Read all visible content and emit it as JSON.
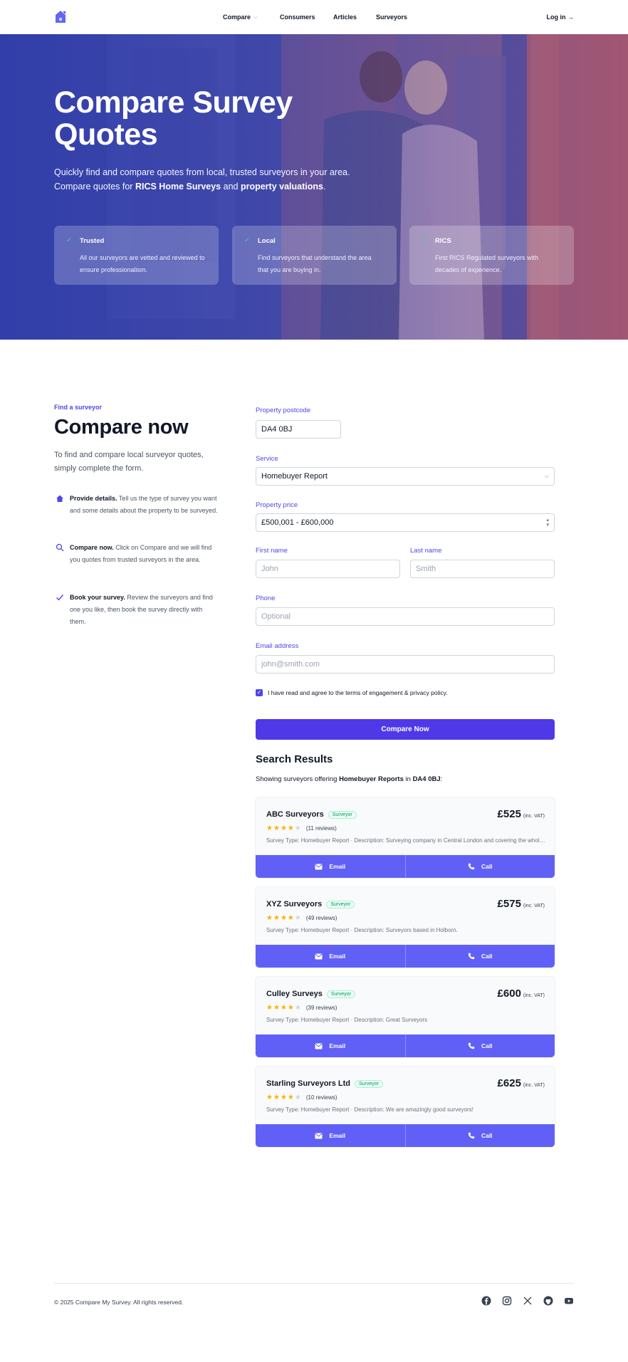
{
  "header": {
    "nav": [
      {
        "label": "Compare"
      },
      {
        "label": "Consumers"
      },
      {
        "label": "Articles"
      },
      {
        "label": "Surveyors"
      }
    ],
    "login_label": "Log in →"
  },
  "hero": {
    "title_line1": "Compare Survey",
    "title_line2": "Quotes",
    "sub_line1": "Quickly find and compare quotes from local, trusted surveyors in your area.",
    "sub_prefix": "Compare quotes for ",
    "sub_bold1": "RICS Home Surveys",
    "sub_and": " and ",
    "sub_bold2": "property valuations",
    "sub_end": ".",
    "features": [
      {
        "title": "Trusted",
        "desc": "All our surveyors are vetted and reviewed to ensure professionalism."
      },
      {
        "title": "Local",
        "desc": "Find surveyors that understand the area that you are buying in."
      },
      {
        "title": "RICS",
        "desc": "First RICS Regulated surveyors with decades of experience."
      }
    ]
  },
  "left": {
    "eyebrow": "Find a surveyor",
    "heading": "Compare now",
    "intro": "To find and compare local surveyor quotes, simply complete the form.",
    "steps": [
      {
        "bold": "Provide details.",
        "text": " Tell us the type of survey you want and some details about the property to be surveyed.",
        "icon": "home-icon"
      },
      {
        "bold": "Compare now.",
        "text": " Click on Compare and we will find you quotes from trusted surveyors in the area.",
        "icon": "search-icon"
      },
      {
        "bold": "Book your survey.",
        "text": " Review the surveyors and find one you like, then book the survey directly with them.",
        "icon": "check-icon"
      }
    ]
  },
  "form": {
    "postcode_label": "Property postcode",
    "postcode_value": "DA4 0BJ",
    "service_label": "Service",
    "service_value": "Homebuyer Report",
    "price_label": "Property price",
    "price_value": "£500,001 - £600,000",
    "first_label": "First name",
    "first_placeholder": "John",
    "last_label": "Last name",
    "last_placeholder": "Smith",
    "phone_label": "Phone",
    "phone_placeholder": "Optional",
    "email_label": "Email address",
    "email_placeholder": "john@smith.com",
    "consent": "I have read and agree to the terms of engagement & privacy policy.",
    "submit": "Compare Now"
  },
  "results": {
    "title": "Search Results",
    "sub_prefix": "Showing surveyors offering ",
    "sub_service": "Homebuyer Reports",
    "sub_in": " in ",
    "sub_postcode": "DA4 0BJ",
    "sub_end": ":",
    "email_label": "Email",
    "call_label": "Call",
    "vat_label": "(inc. VAT)",
    "items": [
      {
        "name": "ABC Surveyors",
        "badge": "Surveyor",
        "price": "£525",
        "rating": 4,
        "reviews": "(11 reviews)",
        "desc": "Survey Type: Homebuyer Report · Description: Surveying company in Central London and covering the whole of London"
      },
      {
        "name": "XYZ Surveyors",
        "badge": "Surveyor",
        "price": "£575",
        "rating": 4,
        "reviews": "(49 reviews)",
        "desc": "Survey Type: Homebuyer Report · Description: Surveyors based in Holborn."
      },
      {
        "name": "Culley Surveys",
        "badge": "Surveyor",
        "price": "£600",
        "rating": 4,
        "reviews": "(39 reviews)",
        "desc": "Survey Type: Homebuyer Report · Description: Great Surveyors"
      },
      {
        "name": "Starling Surveyors Ltd",
        "badge": "Surveyor",
        "price": "£625",
        "rating": 4,
        "reviews": "(10 reviews)",
        "desc": "Survey Type: Homebuyer Report · Description: We are amazingly good surveyors!"
      }
    ]
  },
  "footer": {
    "copyright": "© 2025 Compare My Survey. All rights reserved.",
    "social": [
      "facebook-icon",
      "instagram-icon",
      "x-icon",
      "github-icon",
      "youtube-icon"
    ]
  },
  "colors": {
    "primary": "#4f46e5",
    "button": "#6160f6",
    "star": "#f5b300"
  }
}
